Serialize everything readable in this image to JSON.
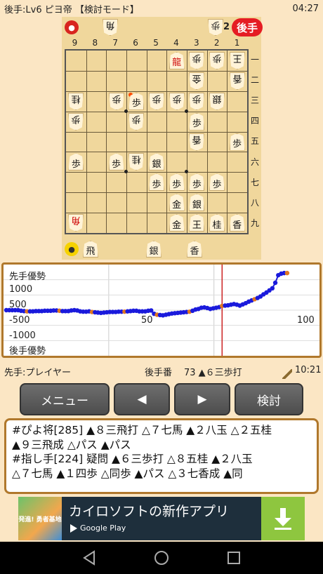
{
  "status": {
    "title": "後手:Lv6 ピヨ帝 【検討モード】",
    "time": "04:27"
  },
  "board": {
    "gote_hand": {
      "count": "2",
      "label": "後手",
      "first_piece": "角",
      "second_piece": "歩"
    },
    "sente_hand": {
      "label": "先手",
      "pieces": [
        "飛",
        "銀",
        "香"
      ]
    },
    "col_labels": [
      "9",
      "8",
      "7",
      "6",
      "5",
      "4",
      "3",
      "2",
      "1"
    ],
    "row_labels": [
      "一",
      "二",
      "三",
      "四",
      "五",
      "六",
      "七",
      "八",
      "九"
    ],
    "pieces": [
      {
        "c": 4,
        "r": 1,
        "t": "龍",
        "s": "sente",
        "red": true
      },
      {
        "c": 3,
        "r": 1,
        "t": "歩",
        "s": "gote"
      },
      {
        "c": 2,
        "r": 1,
        "t": "歩",
        "s": "gote"
      },
      {
        "c": 1,
        "r": 1,
        "t": "王",
        "s": "gote"
      },
      {
        "c": 3,
        "r": 2,
        "t": "金",
        "s": "gote"
      },
      {
        "c": 1,
        "r": 2,
        "t": "香",
        "s": "gote"
      },
      {
        "c": 9,
        "r": 3,
        "t": "桂",
        "s": "gote"
      },
      {
        "c": 7,
        "r": 3,
        "t": "歩",
        "s": "gote"
      },
      {
        "c": 6,
        "r": 3,
        "t": "歩",
        "s": "sente"
      },
      {
        "c": 5,
        "r": 3,
        "t": "歩",
        "s": "gote"
      },
      {
        "c": 4,
        "r": 3,
        "t": "歩",
        "s": "gote"
      },
      {
        "c": 3,
        "r": 3,
        "t": "歩",
        "s": "gote"
      },
      {
        "c": 2,
        "r": 3,
        "t": "銀",
        "s": "gote"
      },
      {
        "c": 9,
        "r": 4,
        "t": "歩",
        "s": "gote"
      },
      {
        "c": 6,
        "r": 4,
        "t": "歩",
        "s": "gote"
      },
      {
        "c": 3,
        "r": 4,
        "t": "歩",
        "s": "sente"
      },
      {
        "c": 3,
        "r": 5,
        "t": "香",
        "s": "gote"
      },
      {
        "c": 1,
        "r": 5,
        "t": "歩",
        "s": "sente"
      },
      {
        "c": 9,
        "r": 6,
        "t": "歩",
        "s": "sente"
      },
      {
        "c": 7,
        "r": 6,
        "t": "歩",
        "s": "sente"
      },
      {
        "c": 6,
        "r": 6,
        "t": "桂",
        "s": "gote"
      },
      {
        "c": 5,
        "r": 6,
        "t": "銀",
        "s": "sente"
      },
      {
        "c": 5,
        "r": 7,
        "t": "歩",
        "s": "sente"
      },
      {
        "c": 4,
        "r": 7,
        "t": "歩",
        "s": "sente"
      },
      {
        "c": 3,
        "r": 7,
        "t": "歩",
        "s": "sente"
      },
      {
        "c": 2,
        "r": 7,
        "t": "歩",
        "s": "sente"
      },
      {
        "c": 4,
        "r": 8,
        "t": "金",
        "s": "sente"
      },
      {
        "c": 3,
        "r": 8,
        "t": "銀",
        "s": "sente"
      },
      {
        "c": 9,
        "r": 9,
        "t": "角",
        "s": "gote",
        "red": true
      },
      {
        "c": 4,
        "r": 9,
        "t": "金",
        "s": "sente"
      },
      {
        "c": 3,
        "r": 9,
        "t": "王",
        "s": "sente"
      },
      {
        "c": 2,
        "r": 9,
        "t": "桂",
        "s": "sente"
      },
      {
        "c": 1,
        "r": 9,
        "t": "香",
        "s": "sente"
      }
    ]
  },
  "graph": {
    "labels": {
      "sente_adv": "先手優勢",
      "p1000": "1000",
      "p500": "500",
      "m500": "-500",
      "m1000": "-1000",
      "gote_adv": "後手優勢",
      "x50": "50",
      "x100": "100"
    },
    "colors": {
      "line": "#1a1adc",
      "cursor": "#cc2222",
      "marker": "#e07820"
    },
    "cursor_move": 73,
    "values": [
      0,
      0,
      0,
      0,
      0,
      -20,
      -30,
      -40,
      -40,
      -40,
      -30,
      -30,
      -30,
      -20,
      -20,
      -20,
      -10,
      -10,
      -20,
      -30,
      -30,
      -30,
      -10,
      0,
      -10,
      -40,
      -50,
      -50,
      -40,
      -60,
      -70,
      -80,
      -90,
      -80,
      -70,
      -60,
      -60,
      -60,
      -50,
      -50,
      -50,
      -40,
      -30,
      -20,
      -20,
      -40,
      -40,
      -40,
      -20,
      -10,
      -120,
      -150,
      -160,
      -170,
      -150,
      -130,
      -110,
      -100,
      -90,
      -80,
      -70,
      -60,
      -50,
      -20,
      20,
      40,
      80,
      90,
      70,
      40,
      60,
      80,
      100,
      140,
      150,
      160,
      180,
      200,
      180,
      150,
      190,
      230,
      280,
      320,
      360,
      400,
      450,
      520,
      580,
      650,
      720,
      900,
      1150,
      1200,
      1220,
      1220
    ]
  },
  "info": {
    "player": "先手:プレイヤー",
    "turn": "後手番",
    "move": "73 ▲６三歩打",
    "time": "10:21"
  },
  "buttons": {
    "menu": "メニュー",
    "prev": "◀",
    "next": "▶",
    "analyze": "検討"
  },
  "notes": [
    "#ぴよ将[285] ▲８三飛打 △７七馬 ▲２八玉 △２五桂",
    "▲９三飛成 △パス ▲パス",
    "#指し手[224] 疑問 ▲６三歩打 △８五桂 ▲２八玉",
    "△７七馬 ▲１四歩 △同歩 ▲パス △３七香成 ▲同"
  ],
  "ad": {
    "thumb_text": "発進!\n勇者基地",
    "title": "カイロソフトの新作アプリ",
    "store": "Google Play"
  }
}
